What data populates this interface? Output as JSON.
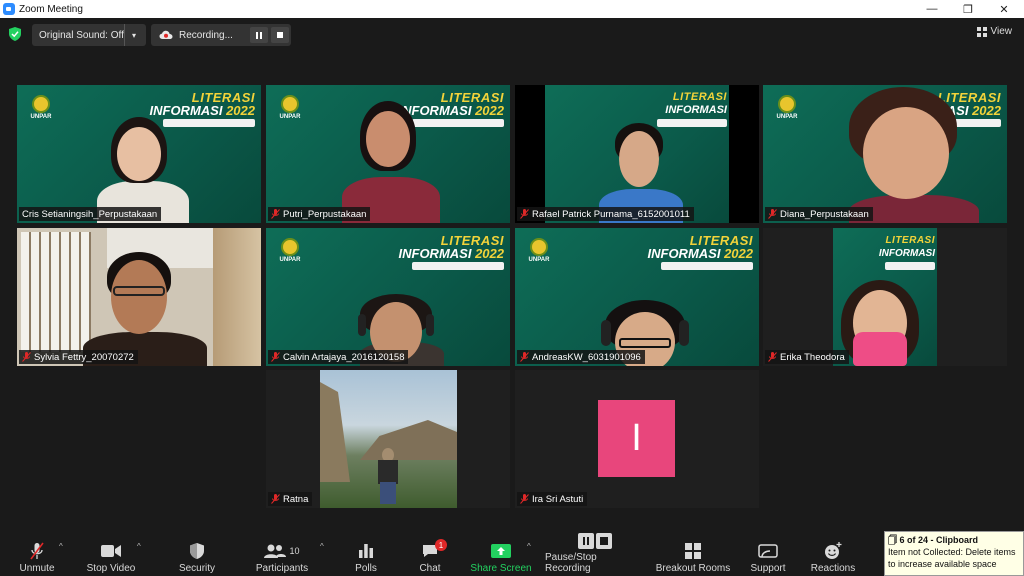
{
  "window": {
    "title": "Zoom Meeting",
    "minimize": "—",
    "restore": "❐",
    "close": "✕"
  },
  "topbar": {
    "original_sound": "Original Sound: Off",
    "recording": "Recording...",
    "view": "View"
  },
  "participants": [
    {
      "name": "Cris Setianingsih_Perpustakaan",
      "muted": false,
      "active": true
    },
    {
      "name": "Putri_Perpustakaan",
      "muted": true
    },
    {
      "name": "Rafael Patrick Purnama_6152001011",
      "muted": true
    },
    {
      "name": "Diana_Perpustakaan",
      "muted": true
    },
    {
      "name": "Sylvia Fettry_20070272",
      "muted": true
    },
    {
      "name": "Calvin Artajaya_2016120158",
      "muted": true
    },
    {
      "name": "AndreasKW_6031901096",
      "muted": true
    },
    {
      "name": "Erika Theodora",
      "muted": true
    },
    {
      "name": "Ratna",
      "muted": true
    },
    {
      "name": "Ira Sri Astuti",
      "muted": true,
      "avatar_letter": "I"
    }
  ],
  "banner": {
    "line1": "LITERASI",
    "line2": "INFORMASI",
    "year": "2022",
    "logo_text": "UNPAR"
  },
  "toolbar": {
    "unmute": "Unmute",
    "stop_video": "Stop Video",
    "security": "Security",
    "participants": "Participants",
    "participants_count": "10",
    "polls": "Polls",
    "chat": "Chat",
    "chat_badge": "1",
    "share_screen": "Share Screen",
    "pause_stop_recording": "Pause/Stop Recording",
    "breakout_rooms": "Breakout Rooms",
    "support": "Support",
    "reactions": "Reactions"
  },
  "clipboard": {
    "title": "6 of 24 - Clipboard",
    "message": "Item not Collected: Delete items to increase available space"
  },
  "colors": {
    "accent_green": "#23d160",
    "active_border": "#c8e64b",
    "avatar_pink": "#e8467c",
    "mute_red": "#e02828",
    "badge_red": "#e02828"
  }
}
